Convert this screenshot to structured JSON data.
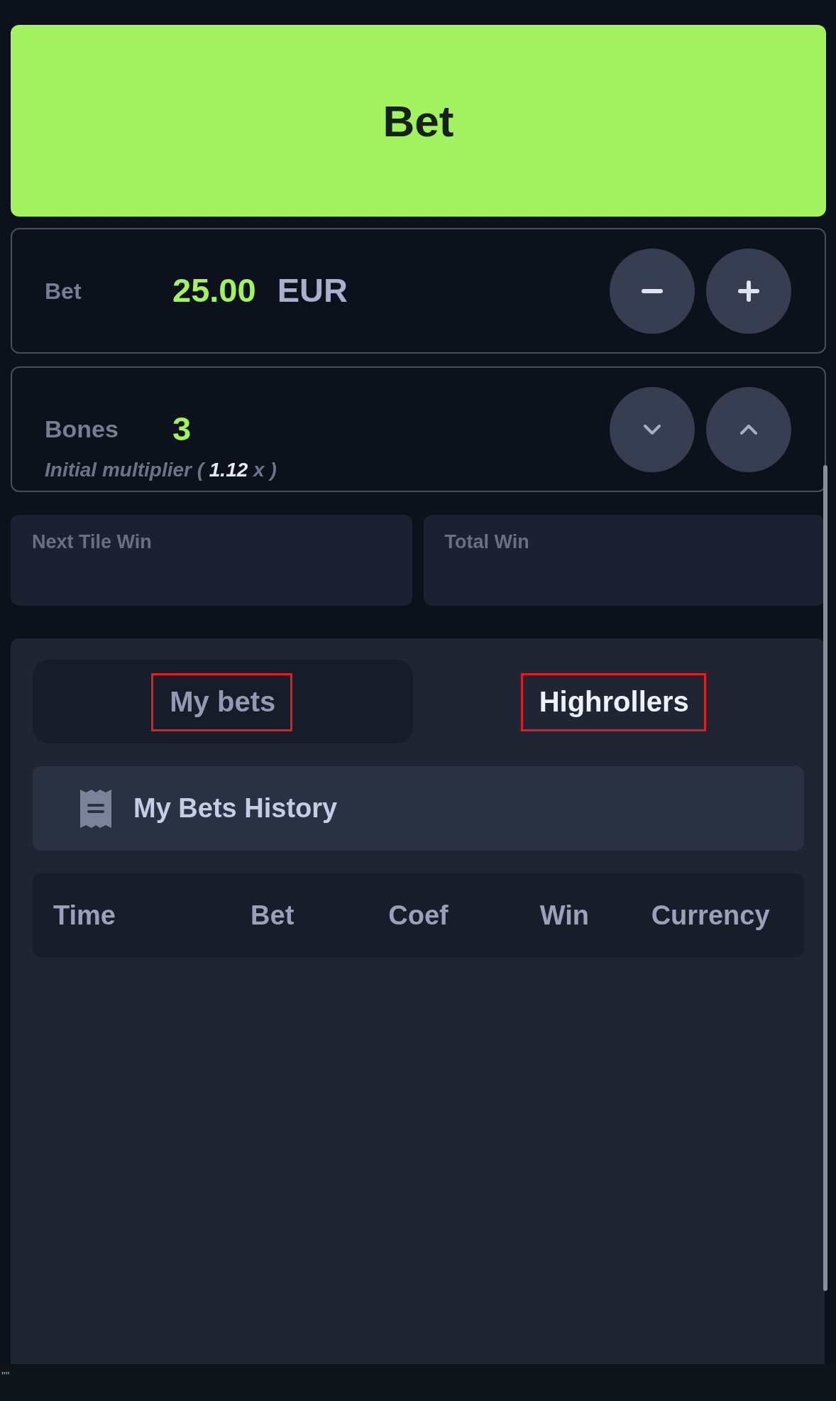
{
  "bet_button": {
    "label": "Bet"
  },
  "bet_amount": {
    "label": "Bet",
    "value": "25.00",
    "currency": "EUR"
  },
  "bones": {
    "label": "Bones",
    "value": "3",
    "multiplier": "Initial multiplier ( **1.12** x )"
  },
  "win_cards": [
    {
      "label": "Next Tile Win"
    },
    {
      "label": "Total Win"
    }
  ],
  "tabs": [
    {
      "label": "My bets",
      "selected": true,
      "highlighted": true
    },
    {
      "label": "Highrollers",
      "selected": false,
      "highlighted": true
    }
  ],
  "history_header": {
    "title": "My Bets History"
  },
  "table": {
    "columns": [
      "Time",
      "Bet",
      "Coef",
      "Win",
      "Currency"
    ]
  },
  "footer_text": "\"\""
}
